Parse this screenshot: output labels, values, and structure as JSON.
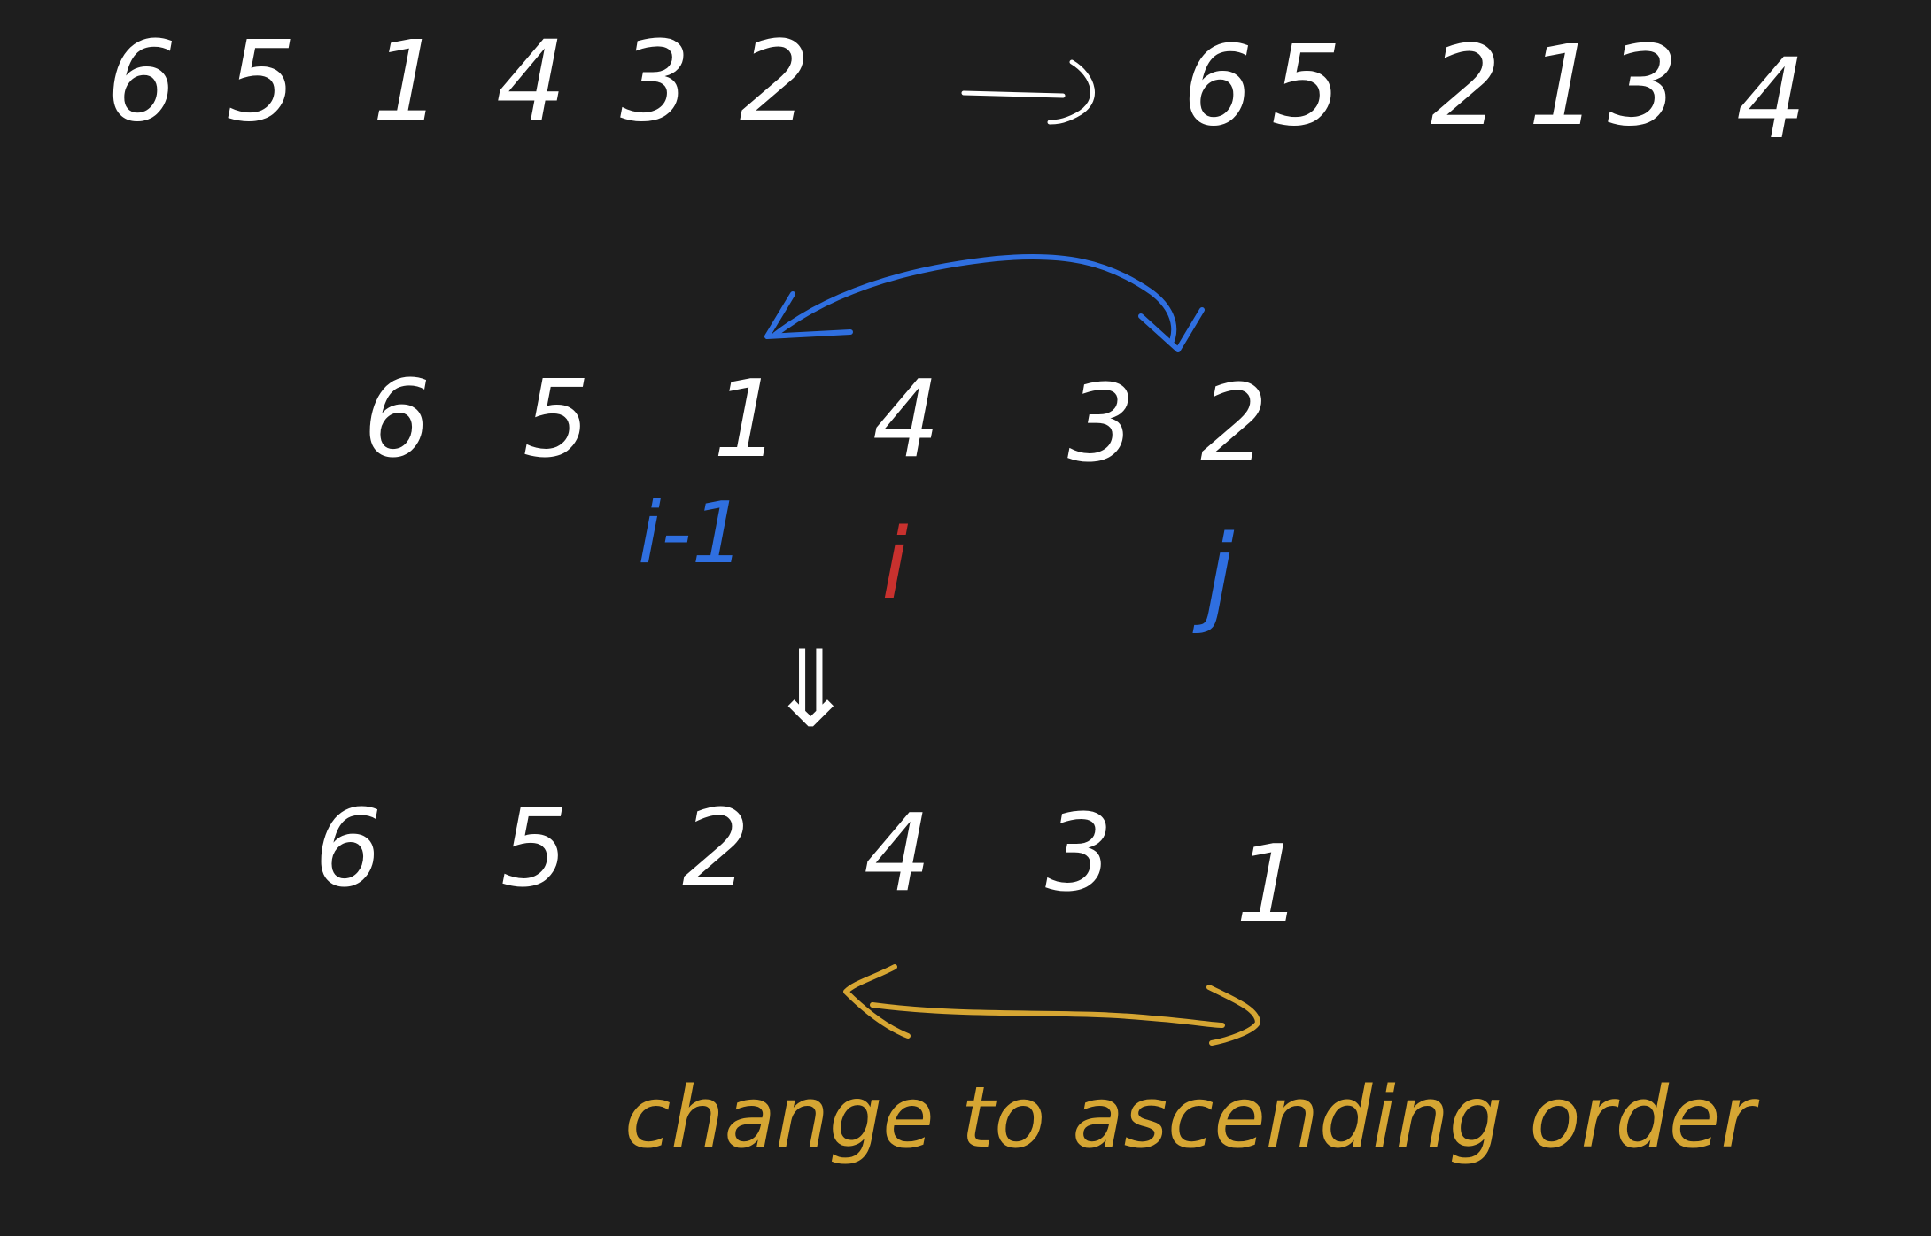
{
  "top_row": {
    "before": [
      "6",
      "5",
      "1",
      "4",
      "3",
      "2"
    ],
    "arrow": "→",
    "after": [
      "6",
      "5",
      "2",
      "1",
      "3",
      "4"
    ]
  },
  "middle_row": {
    "digits": [
      "6",
      "5",
      "1",
      "4",
      "3",
      "2"
    ],
    "labels": {
      "i_minus_1": "i-1",
      "i": "i",
      "j": "j"
    }
  },
  "down_arrow": "⇓",
  "bottom_row": {
    "digits": [
      "6",
      "5",
      "2",
      "4",
      "3",
      "1"
    ]
  },
  "caption": "change to ascending order",
  "colors": {
    "background": "#1e1e1e",
    "ink": "#ffffff",
    "swap_arrow": "#2f6fe0",
    "pointer_i": "#c8312e",
    "reverse_note": "#d6a633"
  }
}
